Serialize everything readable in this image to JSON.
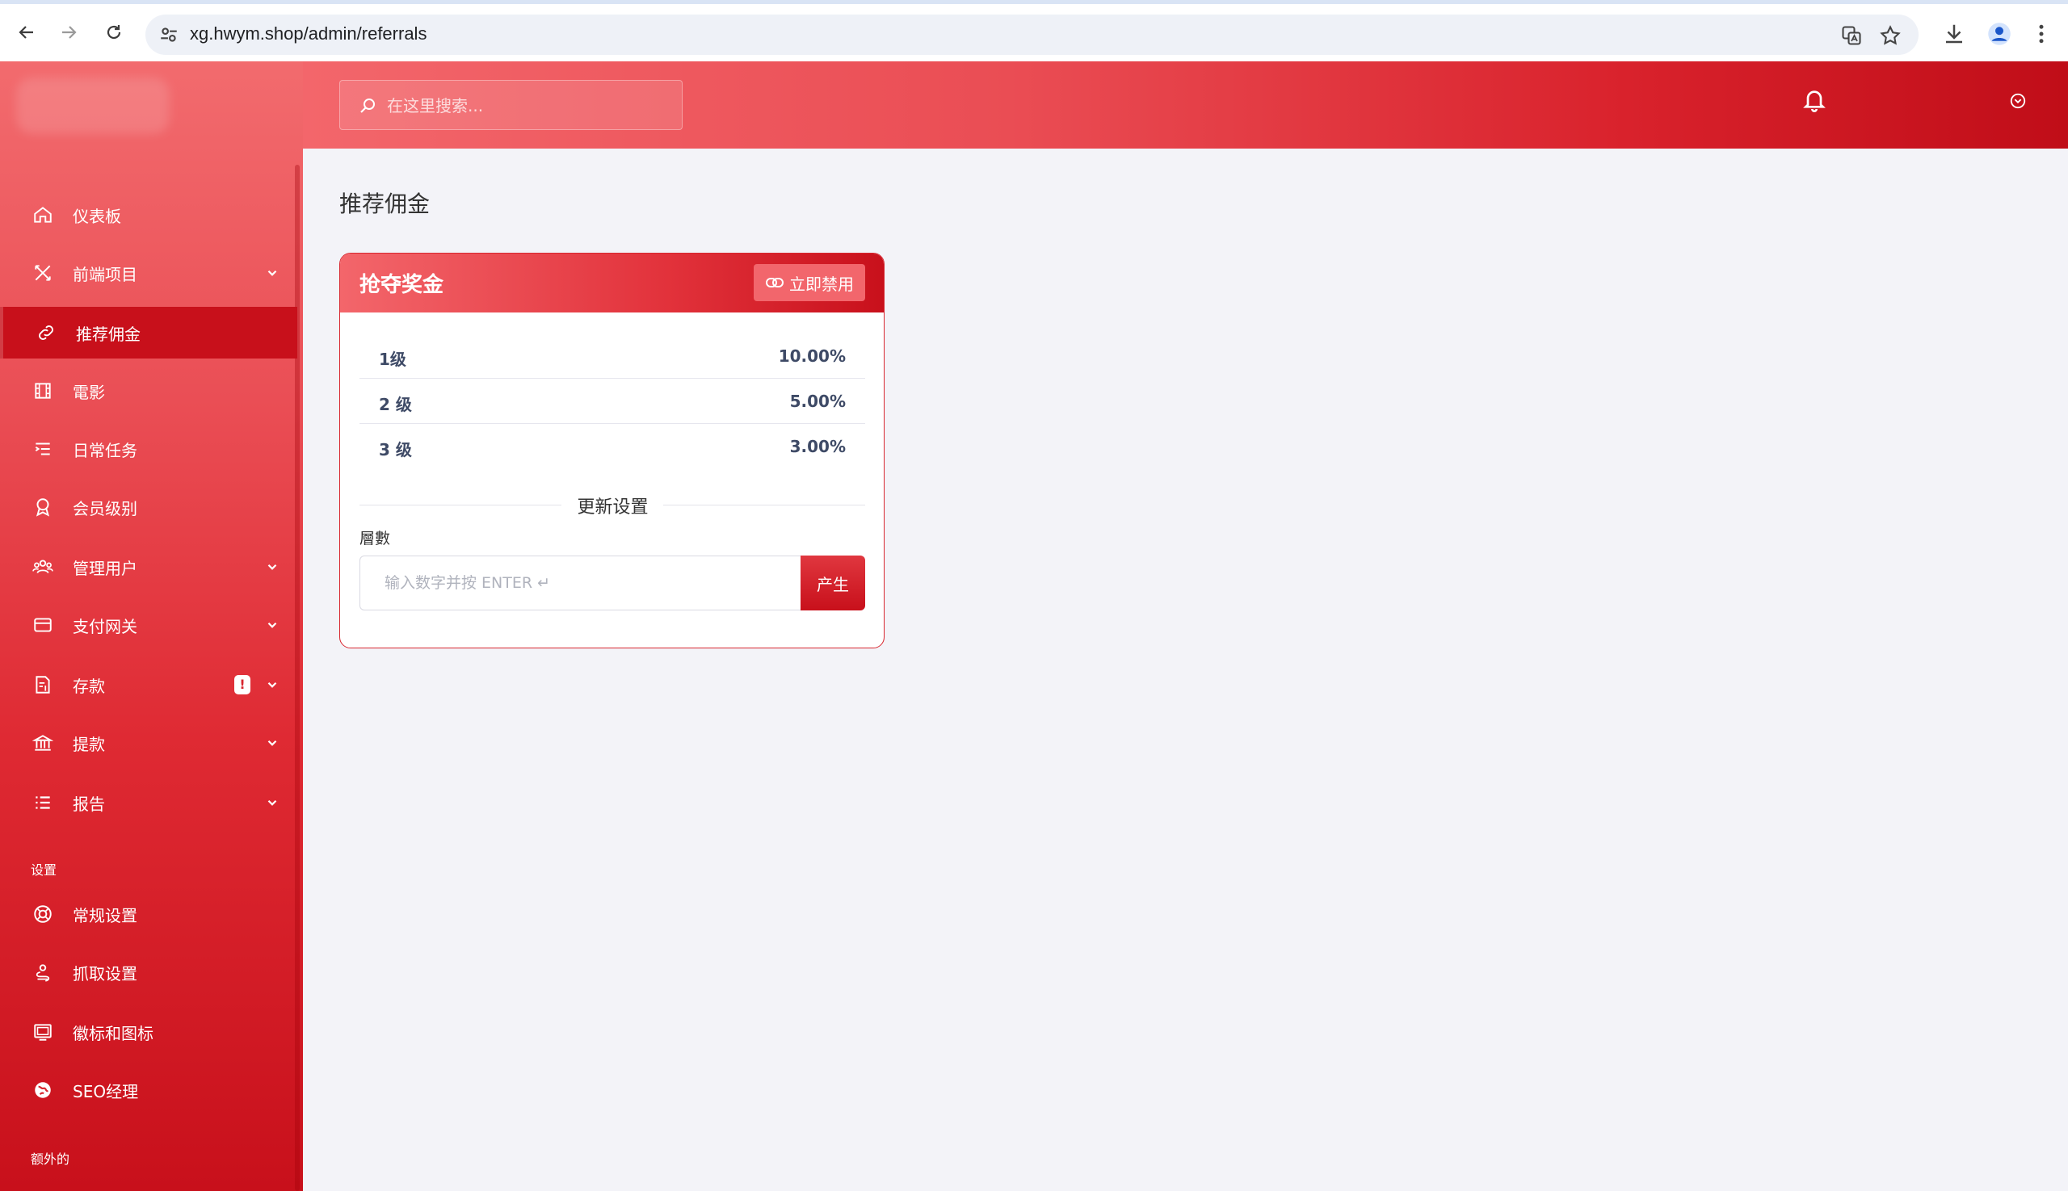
{
  "browser": {
    "url": "xg.hwym.shop/admin/referrals"
  },
  "header": {
    "search_placeholder": "在这里搜索..."
  },
  "sidebar": {
    "items": [
      {
        "label": "仪表板",
        "icon": "home-icon"
      },
      {
        "label": "前端项目",
        "icon": "tools-icon",
        "has_children": true
      },
      {
        "label": "推荐佣金",
        "icon": "link-icon",
        "active": true
      },
      {
        "label": "電影",
        "icon": "film-icon"
      },
      {
        "label": "日常任务",
        "icon": "list-indent-icon"
      },
      {
        "label": "会员级别",
        "icon": "award-icon"
      },
      {
        "label": "管理用户",
        "icon": "users-icon",
        "has_children": true
      },
      {
        "label": "支付网关",
        "icon": "credit-card-icon",
        "has_children": true
      },
      {
        "label": "存款",
        "icon": "deposit-icon",
        "has_children": true,
        "badge": "!"
      },
      {
        "label": "提款",
        "icon": "bank-icon",
        "has_children": true
      },
      {
        "label": "报告",
        "icon": "list-icon",
        "has_children": true
      }
    ],
    "section_settings": "设置",
    "settings_items": [
      {
        "label": "常规设置",
        "icon": "lifebuoy-icon"
      },
      {
        "label": "抓取设置",
        "icon": "spider-icon"
      },
      {
        "label": "徽标和图标",
        "icon": "image-icon"
      },
      {
        "label": "SEO经理",
        "icon": "globe-icon"
      }
    ],
    "section_extra": "额外的"
  },
  "main": {
    "page_title": "推荐佣金",
    "card": {
      "title": "抢夺奖金",
      "disable_button": "立即禁用",
      "levels": [
        {
          "name": "1级",
          "value": "10.00%"
        },
        {
          "name": "2 级",
          "value": "5.00%"
        },
        {
          "name": "3 级",
          "value": "3.00%"
        }
      ],
      "update_divider": "更新设置",
      "layer_label": "層數",
      "layer_placeholder": "输入数字并按 ENTER ↵",
      "generate_button": "产生"
    }
  },
  "colors": {
    "brand_red": "#d8262f",
    "brand_red_dark": "#c8101b",
    "brand_red_light": "#f3666b",
    "page_bg": "#f3f3f8"
  }
}
